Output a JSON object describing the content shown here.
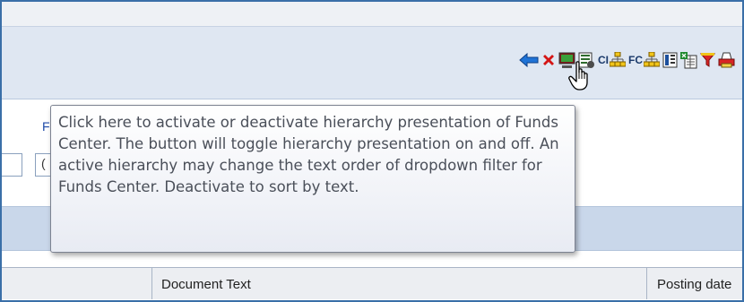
{
  "toolbar": {
    "buttons": [
      {
        "icon": "back-arrow-icon",
        "name": "back-button"
      },
      {
        "icon": "delete-x-icon",
        "name": "delete-button"
      },
      {
        "icon": "monitor-icon",
        "name": "display-button"
      },
      {
        "icon": "settings-list-icon",
        "name": "layout-button"
      },
      {
        "icon": "hierarchy-icon",
        "name": "ci-hierarchy-button",
        "prefix": "CI"
      },
      {
        "icon": "hierarchy-icon",
        "name": "fc-hierarchy-button",
        "prefix": "FC"
      },
      {
        "icon": "columns-icon",
        "name": "columns-button"
      },
      {
        "icon": "export-sheet-icon",
        "name": "export-button"
      },
      {
        "icon": "filter-funnel-icon",
        "name": "filter-button"
      },
      {
        "icon": "print-icon",
        "name": "print-button"
      }
    ],
    "ci_label": "CI",
    "fc_label": "FC"
  },
  "filter": {
    "link_text": "Fi",
    "box_text": "("
  },
  "tooltip": {
    "text": "Click here to activate or deactivate hierarchy presentation of Funds Center. The button will toggle hierarchy presentation on and off. An active hierarchy may change the text order of dropdown filter for Funds Center. Deactivate to sort by text."
  },
  "grid": {
    "columns": [
      "Document Text",
      "Posting date"
    ]
  },
  "colors": {
    "toolbar_bg": "#dfe7f2",
    "band_bg": "#c9d7ea",
    "frame_border": "#3a6fa8"
  }
}
